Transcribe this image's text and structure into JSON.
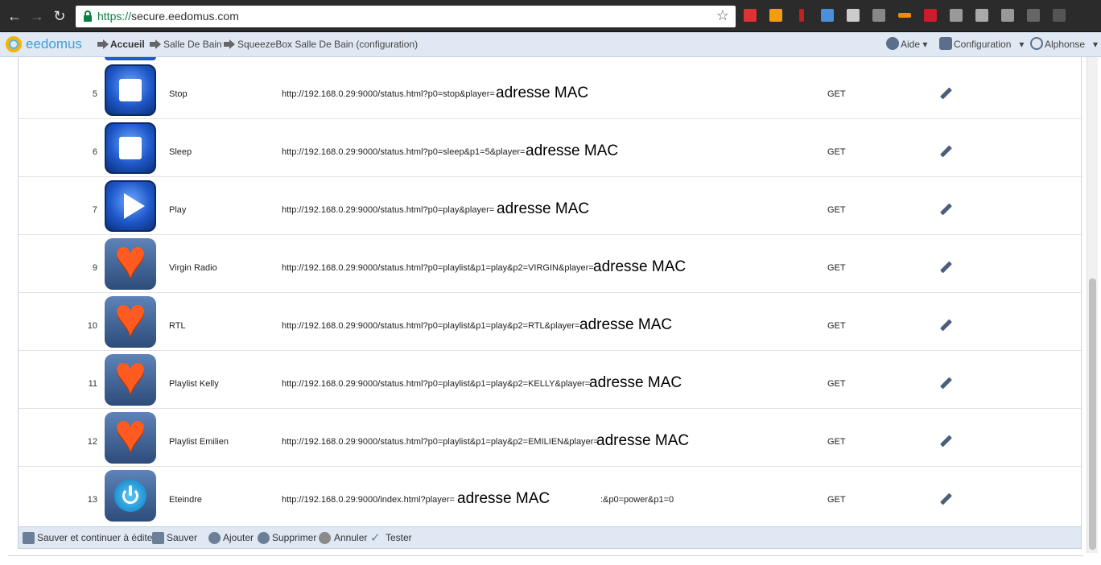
{
  "browser": {
    "url_scheme": "https://",
    "url_host": "secure.eedomus.com",
    "icons": [
      "back-icon",
      "forward-icon",
      "reload-icon",
      "lock-icon",
      "star-icon"
    ]
  },
  "app": {
    "logo": "eedomus",
    "breadcrumbs": [
      {
        "label": "Accueil"
      },
      {
        "label": "Salle De Bain"
      },
      {
        "label": "SqueezeBox Salle De Bain (configuration)"
      }
    ],
    "menu": {
      "help": "Aide",
      "config": "Configuration",
      "user": "Alphonse"
    }
  },
  "rows": [
    {
      "num": "5",
      "name": "Stop",
      "icon": "stop-icon",
      "url": "http://192.168.0.29:9000/status.html?p0=stop&player=",
      "mac": "adresse MAC",
      "extra": "",
      "method": "GET"
    },
    {
      "num": "6",
      "name": "Sleep",
      "icon": "stop-icon",
      "url": "http://192.168.0.29:9000/status.html?p0=sleep&p1=5&player=",
      "mac": "adresse MAC",
      "extra": "",
      "method": "GET"
    },
    {
      "num": "7",
      "name": "Play",
      "icon": "play-icon",
      "url": "http://192.168.0.29:9000/status.html?p0=play&player=",
      "mac": "adresse MAC",
      "extra": "",
      "method": "GET"
    },
    {
      "num": "9",
      "name": "Virgin Radio",
      "icon": "heart-icon",
      "url": "http://192.168.0.29:9000/status.html?p0=playlist&p1=play&p2=VIRGIN&player=",
      "mac": "adresse MAC",
      "extra": "",
      "method": "GET"
    },
    {
      "num": "10",
      "name": "RTL",
      "icon": "heart-icon",
      "url": "http://192.168.0.29:9000/status.html?p0=playlist&p1=play&p2=RTL&player=",
      "mac": "adresse MAC",
      "extra": "",
      "method": "GET"
    },
    {
      "num": "11",
      "name": "Playlist Kelly",
      "icon": "heart-icon",
      "url": "http://192.168.0.29:9000/status.html?p0=playlist&p1=play&p2=KELLY&player=",
      "mac": "adresse MAC",
      "extra": "",
      "method": "GET"
    },
    {
      "num": "12",
      "name": "Playlist Emilien",
      "icon": "heart-icon",
      "url": "http://192.168.0.29:9000/status.html?p0=playlist&p1=play&p2=EMILIEN&player=",
      "mac": "adresse MAC",
      "extra": "",
      "method": "GET"
    },
    {
      "num": "13",
      "name": "Eteindre",
      "icon": "power-icon",
      "url": "http://192.168.0.29:9000/index.html?player=",
      "mac": "adresse MAC",
      "extra": ":&p0=power&p1=0",
      "method": "GET"
    }
  ],
  "toolbar": {
    "save_continue": "Sauver et continuer à éditer",
    "save": "Sauver",
    "add": "Ajouter",
    "delete": "Supprimer",
    "cancel": "Annuler",
    "test": "Tester"
  }
}
